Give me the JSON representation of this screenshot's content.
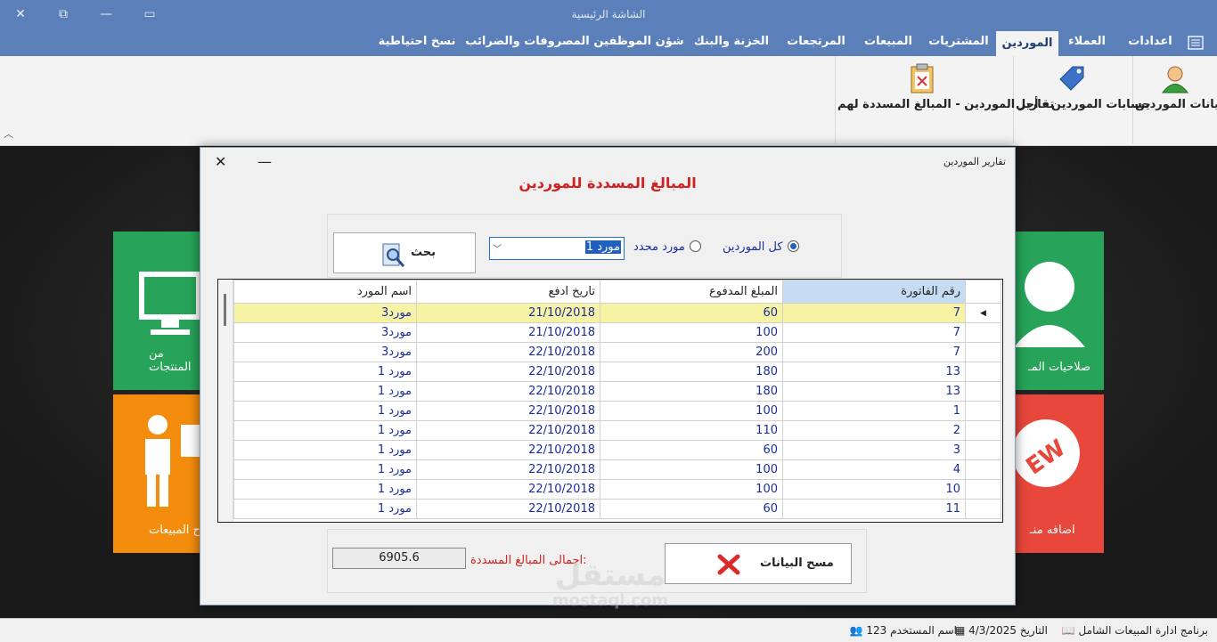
{
  "window": {
    "title": "الشاشة الرئيسية"
  },
  "tabs": [
    {
      "label": "اعدادات"
    },
    {
      "label": "العملاء"
    },
    {
      "label": "الموردين"
    },
    {
      "label": "المشتريات"
    },
    {
      "label": "المبيعات"
    },
    {
      "label": "المرتجعات"
    },
    {
      "label": "الخزنة والبنك"
    },
    {
      "label": "شؤن الموظفين"
    },
    {
      "label": "المصروفات والضرائب"
    },
    {
      "label": "نسخ احتياطية"
    }
  ],
  "ribbon": {
    "supplier_data": "بيانات الموردين",
    "supplier_accounts": "حسابات الموردين - أجل",
    "supplier_reports": "تقارير الموردين - المبالغ المسددة لهم"
  },
  "tiles": {
    "products": "من المنتجات",
    "sales": "ح المبيعات",
    "permissions": "صلاحيات المـ",
    "add": "اضافه منـ"
  },
  "dialog": {
    "title": "تقارير الموردين",
    "heading": "المبالغ المسددة للموردين",
    "radio_all": "كل الموردين",
    "radio_specific": "مورد محدد",
    "supplier_value": "مورد 1",
    "search_label": "بحث",
    "columns": [
      "رقم الفاتورة",
      "المبلغ المدفوع",
      "تاريخ ادفع",
      "اسم المورد"
    ],
    "rows": [
      [
        "7",
        "60",
        "21/10/2018",
        "مورد3"
      ],
      [
        "7",
        "100",
        "21/10/2018",
        "مورد3"
      ],
      [
        "7",
        "200",
        "22/10/2018",
        "مورد3"
      ],
      [
        "13",
        "180",
        "22/10/2018",
        "مورد 1"
      ],
      [
        "13",
        "180",
        "22/10/2018",
        "مورد 1"
      ],
      [
        "1",
        "100",
        "22/10/2018",
        "مورد 1"
      ],
      [
        "2",
        "110",
        "22/10/2018",
        "مورد 1"
      ],
      [
        "3",
        "60",
        "22/10/2018",
        "مورد 1"
      ],
      [
        "4",
        "100",
        "22/10/2018",
        "مورد 1"
      ],
      [
        "10",
        "100",
        "22/10/2018",
        "مورد 1"
      ],
      [
        "11",
        "60",
        "22/10/2018",
        "مورد 1"
      ]
    ],
    "total_label": "اجمالى المبالغ المسددة:",
    "total_value": "6905.6",
    "clear_label": "مسح البيانات"
  },
  "status": {
    "program": "برنامج ادارة المبيعات الشامل",
    "date_label": "التاريخ",
    "date_value": "4/3/2025",
    "user_label": "اسم المستخدم",
    "user_value": "123"
  },
  "watermark": {
    "line1": "مستقل",
    "line2": "mostaql.com"
  },
  "colors": {
    "accent": "#5b7fb8",
    "heading": "#d21f1f",
    "selected_row": "#f6f4a4",
    "link_text": "#1a2c9c"
  }
}
